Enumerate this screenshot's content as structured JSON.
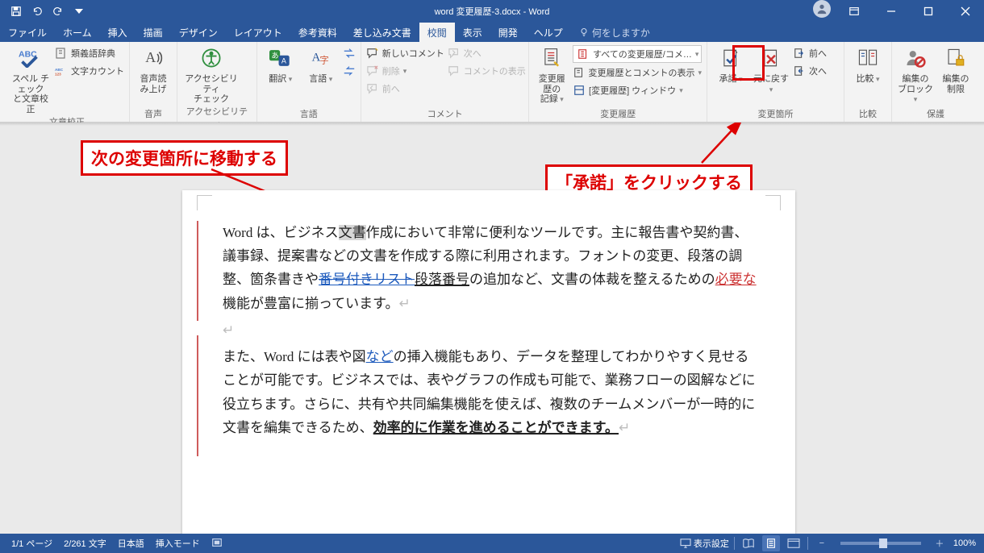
{
  "title": {
    "filename": "word 変更履歴-3.docx",
    "suffix": "  -  Word"
  },
  "tabs": [
    "ファイル",
    "ホーム",
    "挿入",
    "描画",
    "デザイン",
    "レイアウト",
    "参考資料",
    "差し込み文書",
    "校閲",
    "表示",
    "開発",
    "ヘルプ"
  ],
  "tabs_active_index": 8,
  "tell_me": "何をしますか",
  "ribbon": {
    "proofing": {
      "spell": "スペル チェック\nと文章校正",
      "thesaurus": "類義語辞典",
      "wordcount": "文字カウント",
      "group": "文章校正"
    },
    "speech": {
      "readaloud": "音声読\nみ上げ",
      "group": "音声"
    },
    "a11y": {
      "check": "アクセシビリティ\nチェック",
      "group": "アクセシビリティ"
    },
    "language": {
      "translate": "翻訳",
      "lang": "言語",
      "group": "言語"
    },
    "comments": {
      "new": "新しいコメント",
      "delete": "削除",
      "prev": "前へ",
      "next": "次へ",
      "show": "コメントの表示",
      "group": "コメント"
    },
    "tracking": {
      "track": "変更履歴の\n記録",
      "display": "すべての変更履歴/コメ…",
      "showmarkup": "変更履歴とコメントの表示",
      "pane": "[変更履歴] ウィンドウ",
      "group": "変更履歴"
    },
    "changes": {
      "accept": "承諾",
      "reject": "元に戻す",
      "prev": "前へ",
      "next": "次へ",
      "group": "変更箇所"
    },
    "compare": {
      "compare": "比較",
      "group": "比較"
    },
    "protect": {
      "block": "編集の\nブロック",
      "restrict": "編集の\n制限",
      "group": "保護"
    }
  },
  "annotations": {
    "move_next": "次の変更箇所に移動する",
    "click_accept": "「承諾」をクリックする"
  },
  "doc": {
    "p1_pre": "Word は、ビジネス",
    "p1_sel": "文書",
    "p1_post": "作成において非常に便利なツールです。主に報告書や契約書、議事録、提案書などの文書を作成する際に利用されます。フォントの変更、段落の調整、箇条書きや",
    "p1_del": "番号付きリスト",
    "p1_repl": "段落番号",
    "p1_tail1": "の追加など、文書の体裁を整えるための",
    "p1_ins": "必要な",
    "p1_tail2": "機能が豊富に揃っています。",
    "p2_pre": "また、Word には表や図",
    "p2_new": "など",
    "p2_post": "の挿入機能もあり、データを整理してわかりやすく見せることが可能です。ビジネスでは、表やグラフの作成も可能で、業務フローの図解などに役立ちます。さらに、共有や共同編集機能を使えば、複数のチームメンバーが一時的に文書を編集できるため、",
    "p2_bold": "効率的に作業を進めることができます。"
  },
  "status": {
    "page": "1/1 ページ",
    "words": "2/261 文字",
    "lang": "日本語",
    "mode": "挿入モード",
    "display": "表示設定",
    "zoom": "100%"
  }
}
